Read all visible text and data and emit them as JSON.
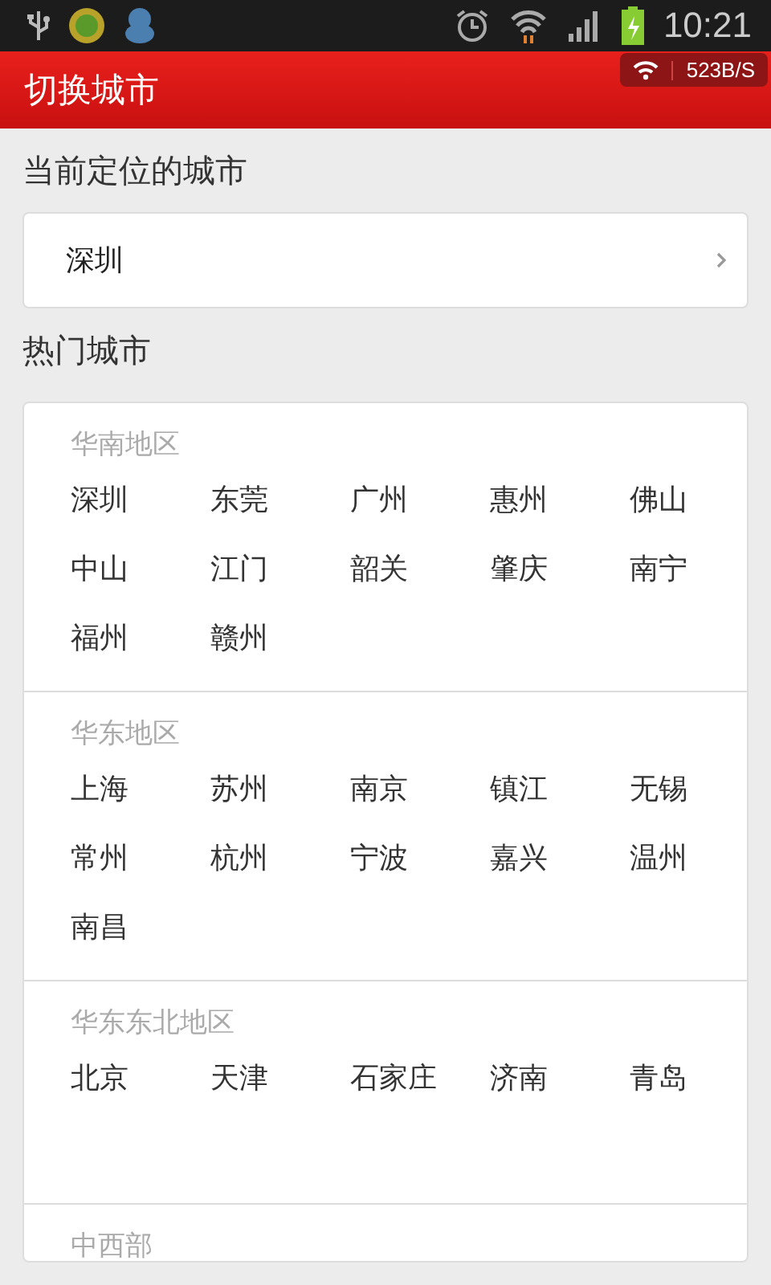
{
  "status_bar": {
    "time": "10:21"
  },
  "app_bar": {
    "title": "切换城市",
    "net_speed": "523B/S"
  },
  "current_location": {
    "heading": "当前定位的城市",
    "city": "深圳"
  },
  "hot_cities": {
    "heading": "热门城市",
    "regions": [
      {
        "name": "华南地区",
        "cities": [
          "深圳",
          "东莞",
          "广州",
          "惠州",
          "佛山",
          "中山",
          "江门",
          "韶关",
          "肇庆",
          "南宁",
          "福州",
          "赣州"
        ]
      },
      {
        "name": "华东地区",
        "cities": [
          "上海",
          "苏州",
          "南京",
          "镇江",
          "无锡",
          "常州",
          "杭州",
          "宁波",
          "嘉兴",
          "温州",
          "南昌"
        ]
      },
      {
        "name": "华东东北地区",
        "cities": [
          "北京",
          "天津",
          "石家庄",
          "济南",
          "青岛"
        ]
      },
      {
        "name": "中西部"
      }
    ]
  }
}
